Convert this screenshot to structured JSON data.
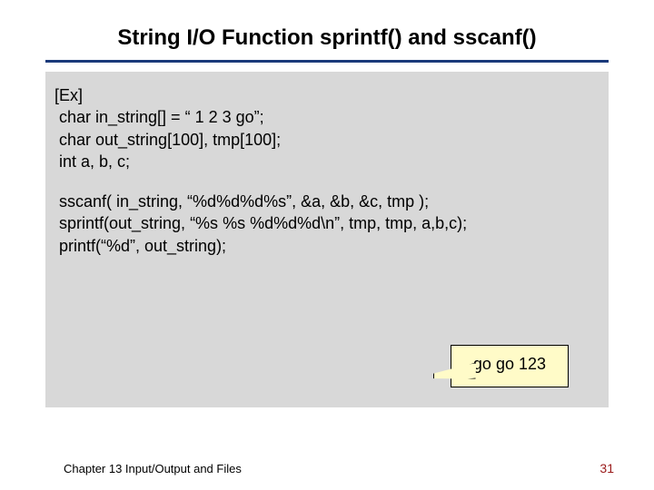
{
  "title": "String I/O Function sprintf() and sscanf()",
  "code": {
    "l1": "[Ex]",
    "l2": " char in_string[] = “ 1 2 3 go”;",
    "l3": " char out_string[100], tmp[100];",
    "l4": " int a, b, c;",
    "l5": " sscanf( in_string, “%d%d%d%s”, &a, &b, &c, tmp );",
    "l6": " sprintf(out_string, “%s %s %d%d%d\\n”, tmp, tmp, a,b,c);",
    "l7": " printf(“%d”, out_string);"
  },
  "callout": "go go 123",
  "footer": {
    "chapter": "Chapter 13   Input/Output and Files",
    "page": "31"
  }
}
